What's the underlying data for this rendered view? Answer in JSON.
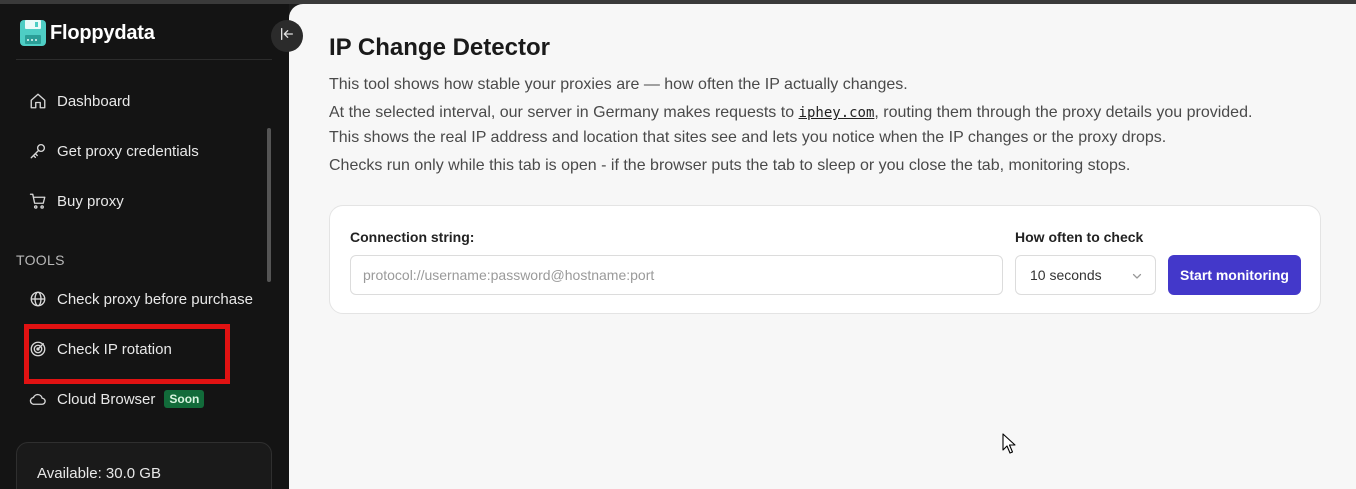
{
  "brand": {
    "name": "Floppydata"
  },
  "sidebar": {
    "items": [
      {
        "label": "Dashboard",
        "icon": "home-icon"
      },
      {
        "label": "Get proxy credentials",
        "icon": "key-icon"
      },
      {
        "label": "Buy proxy",
        "icon": "cart-icon"
      }
    ],
    "tools_label": "TOOLS",
    "tools": [
      {
        "label": "Check proxy before purchase",
        "icon": "globe-icon"
      },
      {
        "label": "Check IP rotation",
        "icon": "radar-icon"
      },
      {
        "label": "Cloud Browser",
        "icon": "cloud-icon",
        "badge": "Soon"
      }
    ],
    "balance": "Available: 30.0 GB"
  },
  "main": {
    "title": "IP Change Detector",
    "line1": "This tool shows how stable your proxies are — how often the IP actually changes.",
    "line2_pre": "At the selected interval, our server in Germany makes requests to ",
    "line2_link": "iphey.com",
    "line2_post": ", routing them through the proxy details you provided.",
    "line3": "This shows the real IP address and location that sites see and lets you notice when the IP changes or the proxy drops.",
    "line4": "Checks run only while this tab is open - if the browser puts the tab to sleep or you close the tab, monitoring stops.",
    "form": {
      "connection_label": "Connection string:",
      "connection_placeholder": "protocol://username:password@hostname:port",
      "connection_value": "",
      "interval_label": "How often to check",
      "interval_value": "10 seconds",
      "start_label": "Start monitoring"
    }
  },
  "colors": {
    "accent": "#4338ca",
    "badge": "#126b3a",
    "highlight": "#e11212",
    "sidebar_bg": "#141414"
  }
}
